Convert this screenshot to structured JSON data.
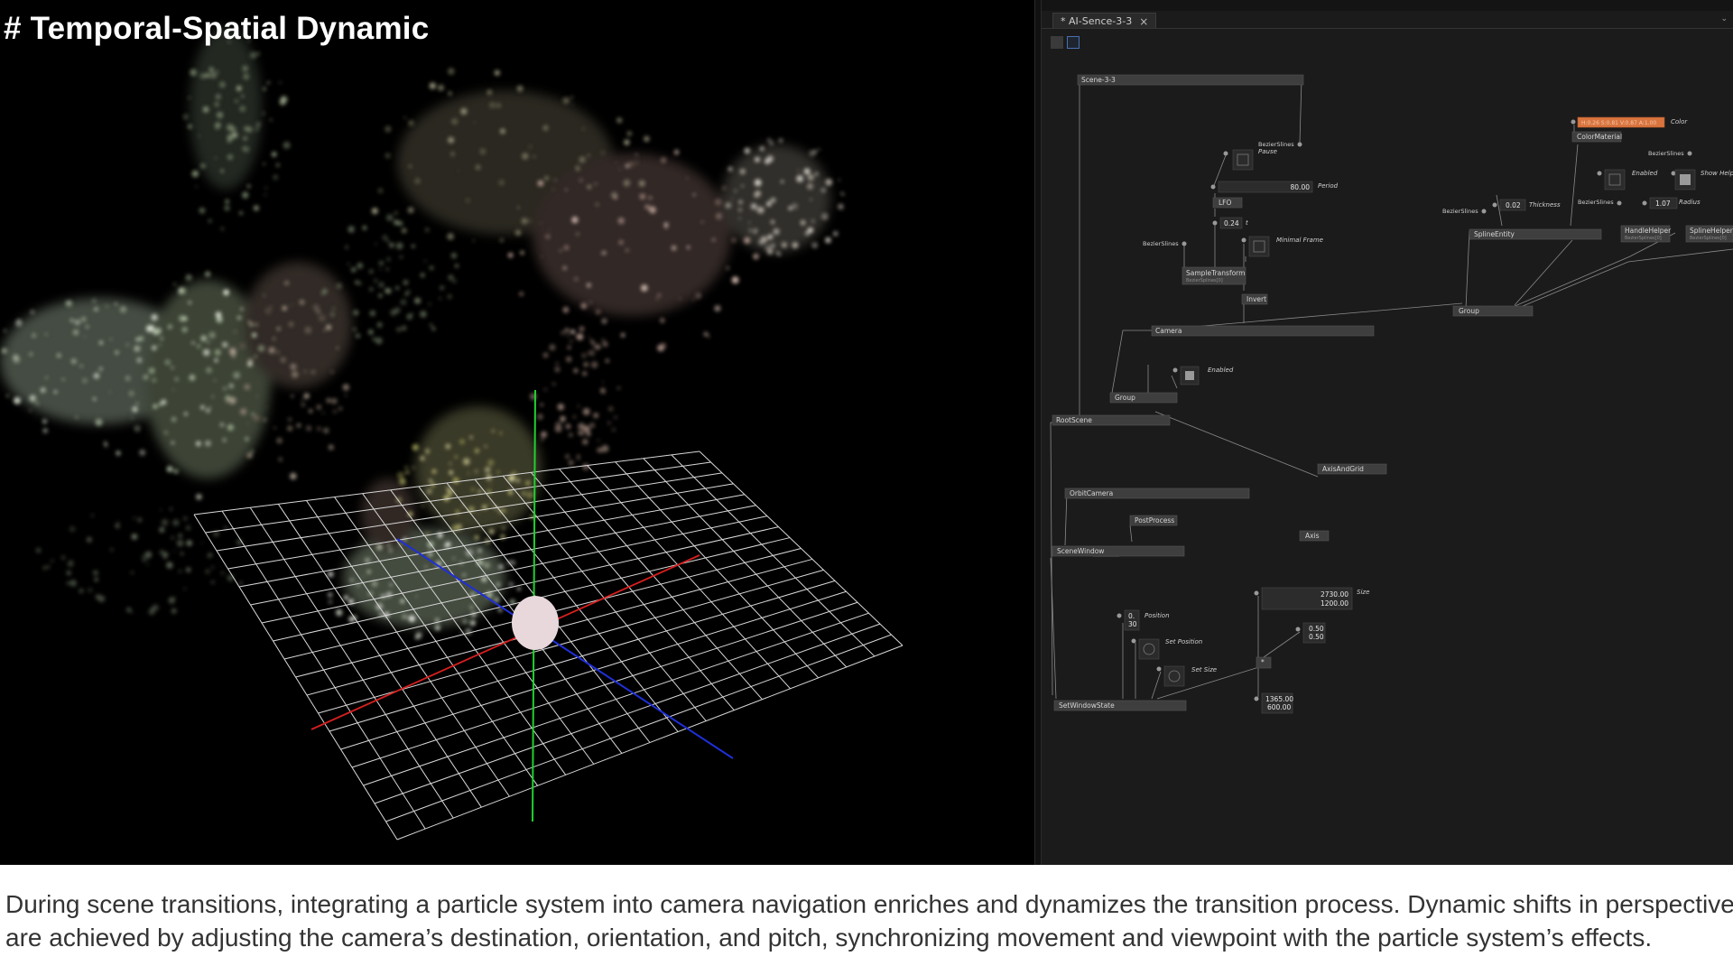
{
  "slide": {
    "title": "# Temporal-Spatial Dynamic",
    "caption_line1": "During scene transitions, integrating a particle system into camera navigation enriches and dynamizes the transition process. Dynamic shifts in perspective",
    "caption_line2": "are achieved by adjusting the camera’s destination, orientation, and pitch, synchronizing movement and viewpoint with the particle system’s effects."
  },
  "editor": {
    "tab_label": "* AI-Sence-3-3",
    "tab_close": "×",
    "menu_chevron": "⌄",
    "nodes": {
      "scene": "Scene-3-3",
      "bezier_pause": "BezierSlines",
      "lfo": "LFO",
      "bezier_sample": "BezierSlines",
      "sample_transform": "SampleTransform",
      "sample_transform_sub": "BezierSplines[0]",
      "invert": "Invert",
      "camera": "Camera",
      "group_left": "Group",
      "root_scene": "RootScene",
      "axis_and_grid": "AxisAndGrid",
      "orbit_camera": "OrbitCamera",
      "post_process": "PostProcess",
      "axis": "Axis",
      "scene_window": "SceneWindow",
      "set_window_state": "SetWindowState",
      "color_material": "ColorMaterial",
      "bezier_enabled": "BezierSlines",
      "bezier_thickness": "BezierSlines",
      "bezier_radius": "BezierSlines",
      "spline_entity": "SplineEntity",
      "handle_helper": "HandleHelper",
      "handle_helper_sub": "BezierSplines[0]",
      "spline_helper": "SplineHelper",
      "spline_helper_sub": "BezierSplines[0]",
      "group_right": "Group"
    },
    "pins": {
      "pause": "Pause",
      "period": "Period",
      "t": "t",
      "minimal_frame": "Minimal Frame",
      "enabled_camera": "Enabled",
      "color": "Color",
      "enabled_right": "Enabled",
      "show_helper": "Show Help",
      "thickness": "Thickness",
      "radius": "Radius",
      "position": "Position",
      "set_position": "Set Position",
      "set_size": "Set Size",
      "size": "Size"
    },
    "values": {
      "period": "80.00",
      "t": "0.24",
      "thickness": "0.02",
      "radius": "1.07",
      "color": "H:0.26 S:0.81 V:0.87 A:1.00",
      "position_x": "0.",
      "position_y": "30",
      "size_w": "2730.00",
      "size_h": "1200.00",
      "scale_x": "0.50",
      "scale_y": "0.50",
      "result_w": "1365.00",
      "result_h": "600.00",
      "multiply_op": "*"
    },
    "colors": {
      "background": "#1b1b1b",
      "node": "#3a3a3a",
      "wire": "#8a8a8a",
      "color_pin": "#d9743f"
    }
  },
  "viewport": {
    "axis_colors": {
      "x": "#d61f1f",
      "y": "#1fd12e",
      "z": "#1f2fd6"
    },
    "grid_color": "#d8d8d8"
  }
}
